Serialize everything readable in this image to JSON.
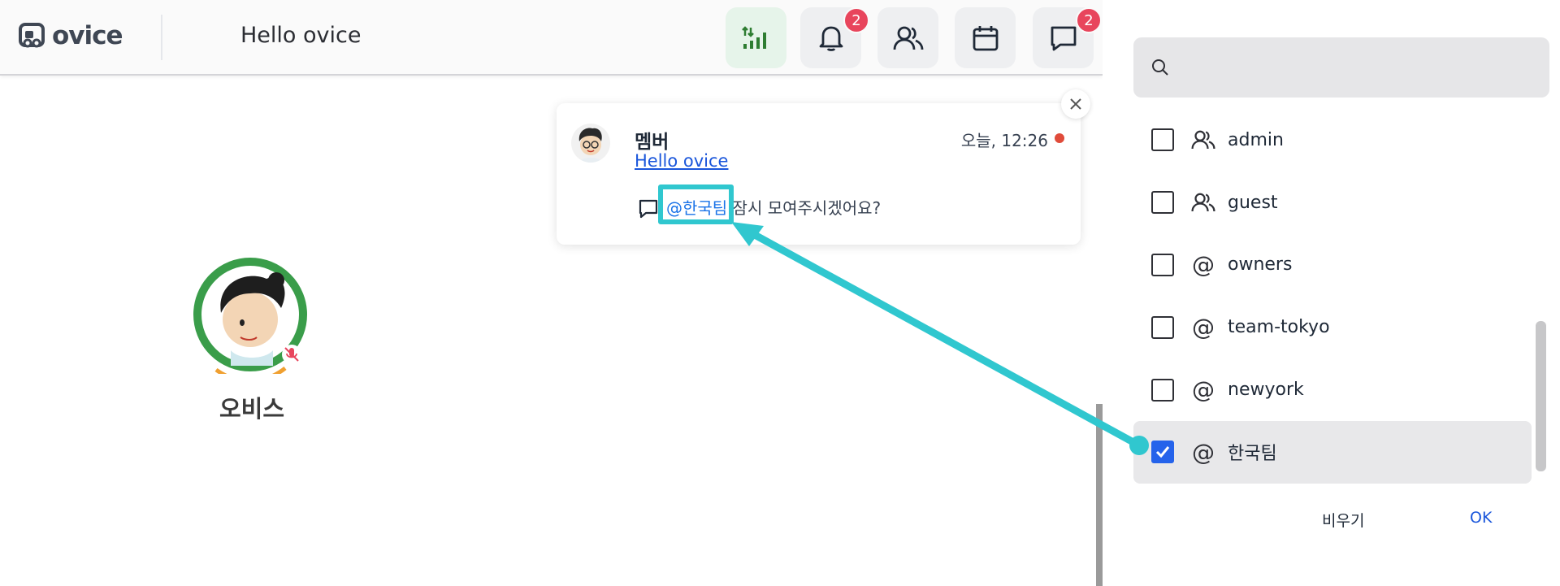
{
  "header": {
    "logo_text": "ovice",
    "title": "Hello ovice",
    "buttons": [
      {
        "name": "signal",
        "icon": "signal-icon",
        "badge": null
      },
      {
        "name": "notifications",
        "icon": "bell-icon",
        "badge": "2"
      },
      {
        "name": "members",
        "icon": "users-icon",
        "badge": null
      },
      {
        "name": "calendar",
        "icon": "calendar-icon",
        "badge": null
      },
      {
        "name": "chat",
        "icon": "chat-icon",
        "badge": "2"
      }
    ]
  },
  "notification": {
    "sender": "멤버",
    "link": "Hello ovice",
    "time": "오늘, 12:26",
    "mention": "@한국팀",
    "message": " 잠시 모여주시겠어요?"
  },
  "user": {
    "name": "오비스"
  },
  "panel": {
    "search_placeholder": "",
    "items": [
      {
        "label": "admin",
        "icon": "users-icon",
        "checked": false
      },
      {
        "label": "guest",
        "icon": "users-icon",
        "checked": false
      },
      {
        "label": "owners",
        "icon": "at-icon",
        "checked": false
      },
      {
        "label": "team-tokyo",
        "icon": "at-icon",
        "checked": false
      },
      {
        "label": "newyork",
        "icon": "at-icon",
        "checked": false
      },
      {
        "label": "한국팀",
        "icon": "at-icon",
        "checked": true
      }
    ],
    "clear_label": "비우기",
    "ok_label": "OK"
  },
  "colors": {
    "accent": "#2563eb",
    "annotation": "#30c7cf",
    "badge": "#e8455c"
  }
}
